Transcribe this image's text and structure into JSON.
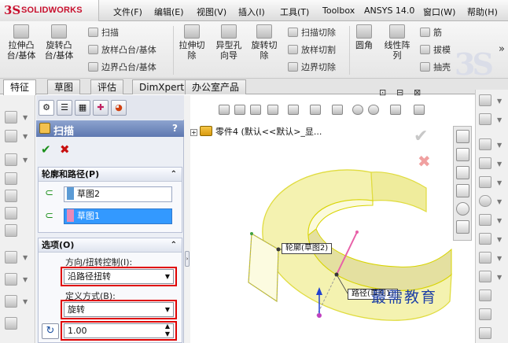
{
  "brand": {
    "logo_text": "SOLIDWORKS",
    "accent": "#c8102e"
  },
  "menu": {
    "items": [
      "文件(F)",
      "编辑(E)",
      "视图(V)",
      "插入(I)",
      "工具(T)",
      "Toolbox",
      "ANSYS 14.0",
      "窗口(W)",
      "帮助(H)"
    ]
  },
  "command_manager": {
    "big_buttons": [
      "拉伸凸\n台/基体",
      "旋转凸\n台/基体",
      "拉伸切\n除",
      "异型孔\n向导",
      "旋转切\n除",
      "圆角",
      "线性阵\n列"
    ],
    "small_buttons": [
      "扫描",
      "放样凸台/基体",
      "边界凸台/基体",
      "扫描切除",
      "放样切割",
      "边界切除",
      "筋",
      "拔模",
      "抽壳"
    ],
    "more_symbol": "»"
  },
  "tabs": [
    "特征",
    "草图",
    "评估",
    "DimXpert",
    "办公室产品"
  ],
  "property_manager": {
    "title": "扫描",
    "help": "?",
    "ok_symbol": "✔",
    "cancel_symbol": "✖",
    "profile_group": {
      "title": "轮廓和路径(P)",
      "collapse": "⌃",
      "profile_value": "草图2",
      "path_value": "草图1",
      "profile_color": "#5b9bd5",
      "path_color": "#e88ab8"
    },
    "options_group": {
      "title": "选项(O)",
      "collapse": "⌃",
      "orientation_label": "方向/扭转控制(I):",
      "orientation_value": "沿路径扭转",
      "define_label": "定义方式(B):",
      "define_value": "旋转",
      "twist_value": "1.00"
    },
    "highlight_color": "#e00000"
  },
  "feature_tree": {
    "expand_symbol": "+",
    "node_label": "零件4  (默认<<默认>_显..."
  },
  "graphics": {
    "profile_tag": "轮廓(草图2)",
    "path_tag": "路径(草图1)",
    "confirm_symbol": "✔",
    "cancel_symbol": "✖",
    "watermark": "最需教育",
    "model_color": "#f2efa0",
    "edge_color": "#d8d400"
  },
  "window_controls": [
    "⊡",
    "⊟",
    "⊠"
  ]
}
